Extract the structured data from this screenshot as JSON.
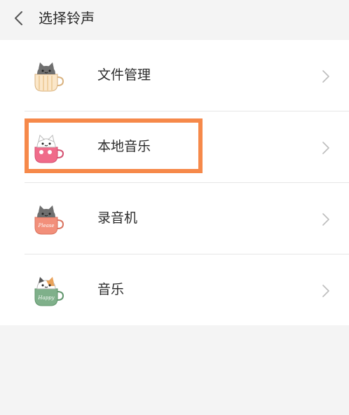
{
  "header": {
    "title": "选择铃声",
    "back_icon": "chevron-left-icon"
  },
  "items": [
    {
      "label": "文件管理",
      "icon": "cat-cup-stripes-icon"
    },
    {
      "label": "本地音乐",
      "icon": "cat-cup-pink-icon"
    },
    {
      "label": "录音机",
      "icon": "cat-cup-please-icon"
    },
    {
      "label": "音乐",
      "icon": "cat-cup-happy-icon"
    }
  ],
  "cup_text": {
    "please": "Please",
    "happy": "Happy"
  },
  "colors": {
    "highlight": "#f6894a",
    "background": "#f4f4f4",
    "list_background": "#ffffff",
    "chevron": "#bdbdbd"
  }
}
